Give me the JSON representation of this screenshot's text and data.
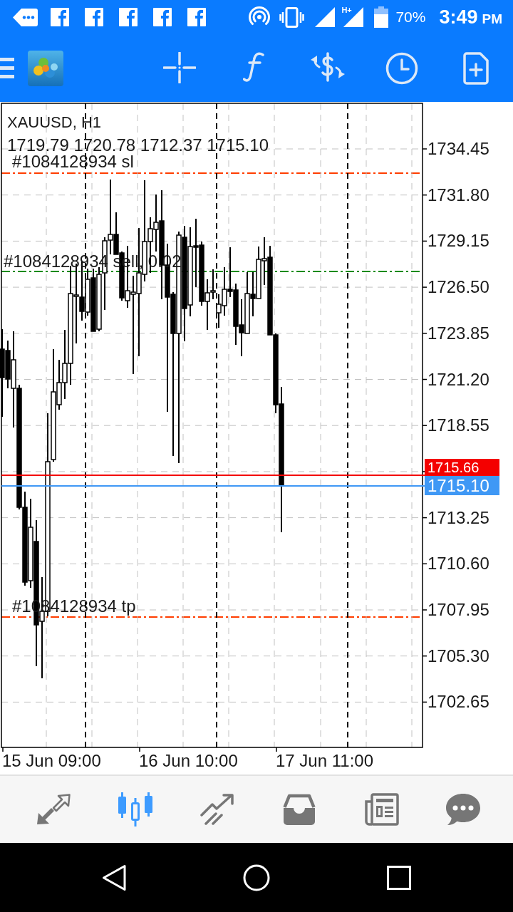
{
  "status_bar": {
    "network": "H+",
    "battery": "70%",
    "time": "3:49",
    "meridiem": "PM"
  },
  "chart": {
    "symbol": "XAUUSD, H1",
    "ohlc": "1719.79 1720.78 1712.37 1715.10",
    "order_lines": [
      {
        "kind": "stop_loss",
        "label": "#1084128934 sl"
      },
      {
        "kind": "order",
        "label": "#1084128934 sell, 0.02"
      },
      {
        "kind": "take_profit",
        "label": "#1084128934 tp"
      }
    ],
    "price_axis": [
      "1734.45",
      "1731.80",
      "1729.15",
      "1726.50",
      "1723.85",
      "1721.20",
      "1718.55",
      "1713.25",
      "1710.60",
      "1707.95",
      "1705.30",
      "1702.65"
    ],
    "ask_price": "1715.66",
    "bid_price": "1715.10",
    "time_axis": [
      "15 Jun 09:00",
      "16 Jun 10:00",
      "17 Jun 11:00"
    ]
  },
  "bottom_nav": [
    {
      "kind": "quotes",
      "selected": false
    },
    {
      "kind": "chart",
      "selected": true
    },
    {
      "kind": "trade",
      "selected": false
    },
    {
      "kind": "history",
      "selected": false
    },
    {
      "kind": "news",
      "selected": false
    },
    {
      "kind": "chat",
      "selected": false
    }
  ]
}
